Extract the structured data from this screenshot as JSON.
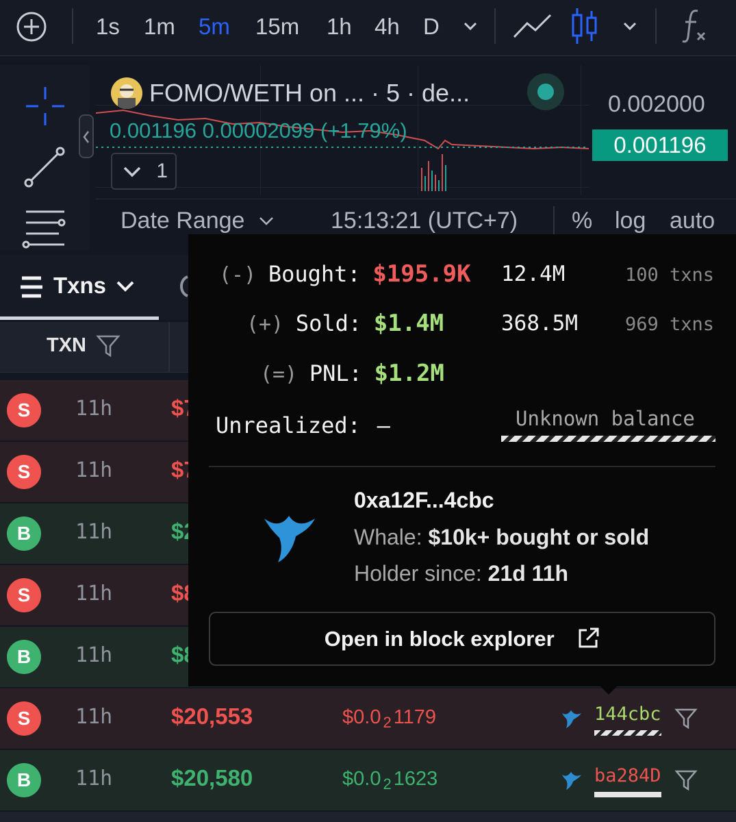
{
  "toolbar": {
    "intervals": [
      "1s",
      "1m",
      "5m",
      "15m",
      "1h",
      "4h",
      "D"
    ],
    "active_interval": "5m",
    "icons": [
      "plus-circle-icon",
      "chevron-down-icon",
      "line-chart-icon",
      "candlestick-icon",
      "chevron-down-icon",
      "function-icon"
    ]
  },
  "left_tools": [
    "crosshair-icon",
    "trend-line-icon",
    "fib-levels-icon"
  ],
  "chart": {
    "legend_title": "FOMO/WETH on ... · 5 · de...",
    "legend_values": "0.001196 0.00002099 (+1.79%)",
    "price_scale_top": "0.002000",
    "last_price": "0.001196",
    "series_toggle": "1",
    "date_range_label": "Date Range",
    "clock": "15:13:21 (UTC+7)",
    "scale_percent": "%",
    "scale_log": "log",
    "scale_auto": "auto",
    "colors": {
      "up": "#26a69a",
      "down": "#ef5350",
      "accent": "#2962ff"
    }
  },
  "txns": {
    "tab_label": "Txns",
    "col_txn": "TXN",
    "rows": [
      {
        "type": "S",
        "age": "11h",
        "amount": "$7",
        "price": "",
        "maker": ""
      },
      {
        "type": "S",
        "age": "11h",
        "amount": "$7",
        "price": "",
        "maker": ""
      },
      {
        "type": "B",
        "age": "11h",
        "amount": "$2",
        "price": "",
        "maker": ""
      },
      {
        "type": "S",
        "age": "11h",
        "amount": "$8",
        "price": "",
        "maker": ""
      },
      {
        "type": "B",
        "age": "11h",
        "amount": "$8",
        "price": "",
        "maker": ""
      },
      {
        "type": "S",
        "age": "11h",
        "amount": "$20,553",
        "price_prefix": "$0.0",
        "price_sub": "2",
        "price_rest": "1179",
        "maker": "144cbc"
      },
      {
        "type": "B",
        "age": "11h",
        "amount": "$20,580",
        "price_prefix": "$0.0",
        "price_sub": "2",
        "price_rest": "1623",
        "maker": "ba284D"
      }
    ]
  },
  "popup": {
    "bought_sign": "(-)",
    "bought_label": "Bought:",
    "bought_usd": "$195.9K",
    "bought_tokens": "12.4M",
    "bought_txns": "100 txns",
    "sold_sign": "(+)",
    "sold_label": "Sold:",
    "sold_usd": "$1.4M",
    "sold_tokens": "368.5M",
    "sold_txns": "969 txns",
    "pnl_sign": "(=)",
    "pnl_label": "PNL:",
    "pnl_usd": "$1.2M",
    "unrealized_label": "Unrealized:",
    "unrealized_value": "–",
    "unknown_balance": "Unknown balance",
    "wallet_address": "0xa12F...4cbc",
    "whale_label": "Whale:",
    "whale_desc": "$10k+ bought or sold",
    "holder_label": "Holder since:",
    "holder_value": "21d 11h",
    "explorer_button": "Open in block explorer"
  }
}
